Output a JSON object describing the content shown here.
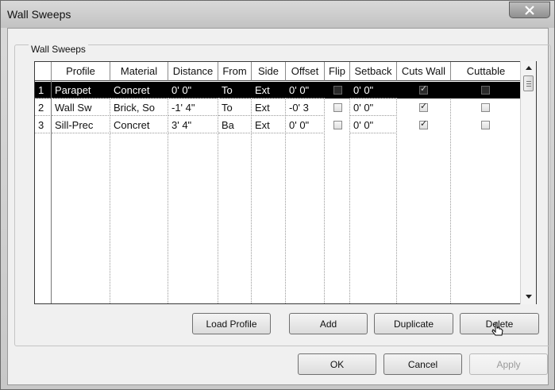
{
  "window": {
    "title": "Wall Sweeps"
  },
  "group": {
    "label": "Wall Sweeps"
  },
  "table": {
    "headers": [
      "",
      "Profile",
      "Material",
      "Distance",
      "From",
      "Side",
      "Offset",
      "Flip",
      "Setback",
      "Cuts Wall",
      "Cuttable"
    ],
    "rows": [
      {
        "num": "1",
        "profile": "Parapet",
        "material": "Concret",
        "distance": "0'  0\"",
        "from": "To",
        "side": "Ext",
        "offset": "0'  0\"",
        "flip": false,
        "setback": "0'  0\"",
        "cuts_wall": true,
        "cuttable": false,
        "selected": true
      },
      {
        "num": "2",
        "profile": "Wall Sw",
        "material": "Brick, So",
        "distance": "-1'  4\"",
        "from": "To",
        "side": "Ext",
        "offset": "-0'  3",
        "flip": false,
        "setback": "0'  0\"",
        "cuts_wall": true,
        "cuttable": false,
        "selected": false
      },
      {
        "num": "3",
        "profile": "Sill-Prec",
        "material": "Concret",
        "distance": "3'  4\"",
        "from": "Ba",
        "side": "Ext",
        "offset": "0'  0\"",
        "flip": false,
        "setback": "0'  0\"",
        "cuts_wall": true,
        "cuttable": false,
        "selected": false
      }
    ]
  },
  "buttons": {
    "load_profile": "Load Profile",
    "add": "Add",
    "duplicate": "Duplicate",
    "delete": "Delete",
    "ok": "OK",
    "cancel": "Cancel",
    "apply": "Apply"
  },
  "icons": {
    "close": "close-icon",
    "scroll_up": "scroll-up-arrow-icon",
    "scroll_down": "scroll-down-arrow-icon",
    "cursor": "mouse-pointer-icon"
  }
}
